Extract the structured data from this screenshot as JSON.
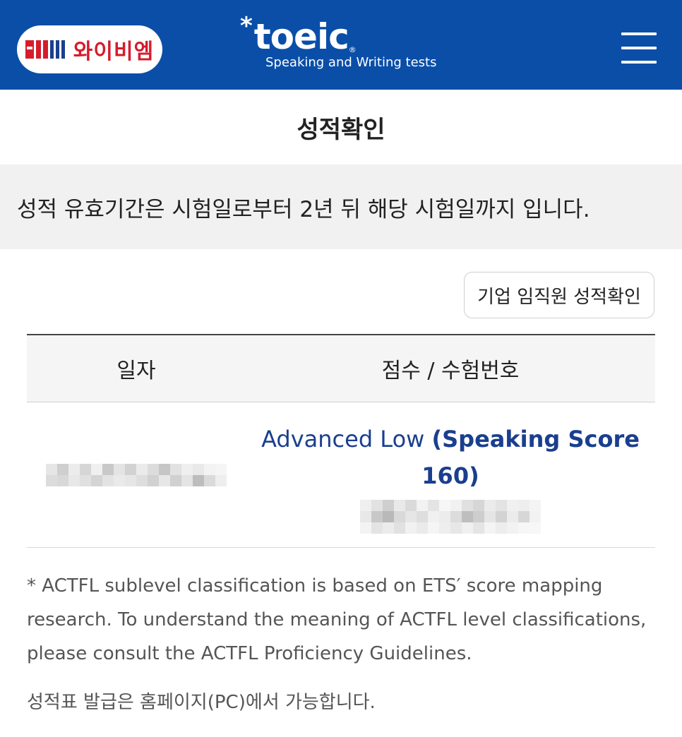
{
  "header": {
    "ybm_logo_text": "와이비엠",
    "toeic_star": "*",
    "toeic_name": "toeic",
    "toeic_reg": "®",
    "toeic_subtitle": "Speaking and Writing tests",
    "brand_color": "#0a4ea8"
  },
  "page": {
    "title": "성적확인",
    "notice": "성적 유효기간은 시험일로부터 2년 뒤 해당 시험일까지 입니다.",
    "corp_button": "기업 임직원 성적확인"
  },
  "table": {
    "headers": [
      "일자",
      "점수 / 수험번호"
    ],
    "rows": [
      {
        "level": "Advanced Low",
        "score_detail": "(Speaking Score 160)"
      }
    ]
  },
  "footnote": "* ACTFL sublevel classification is based on ETS′ score mapping research. To understand the meaning of ACTFL level classifications, please consult the ACTFL Proficiency Guidelines.",
  "footnote_2": "성적표 발급은 홈페이지(PC)에서 가능합니다."
}
